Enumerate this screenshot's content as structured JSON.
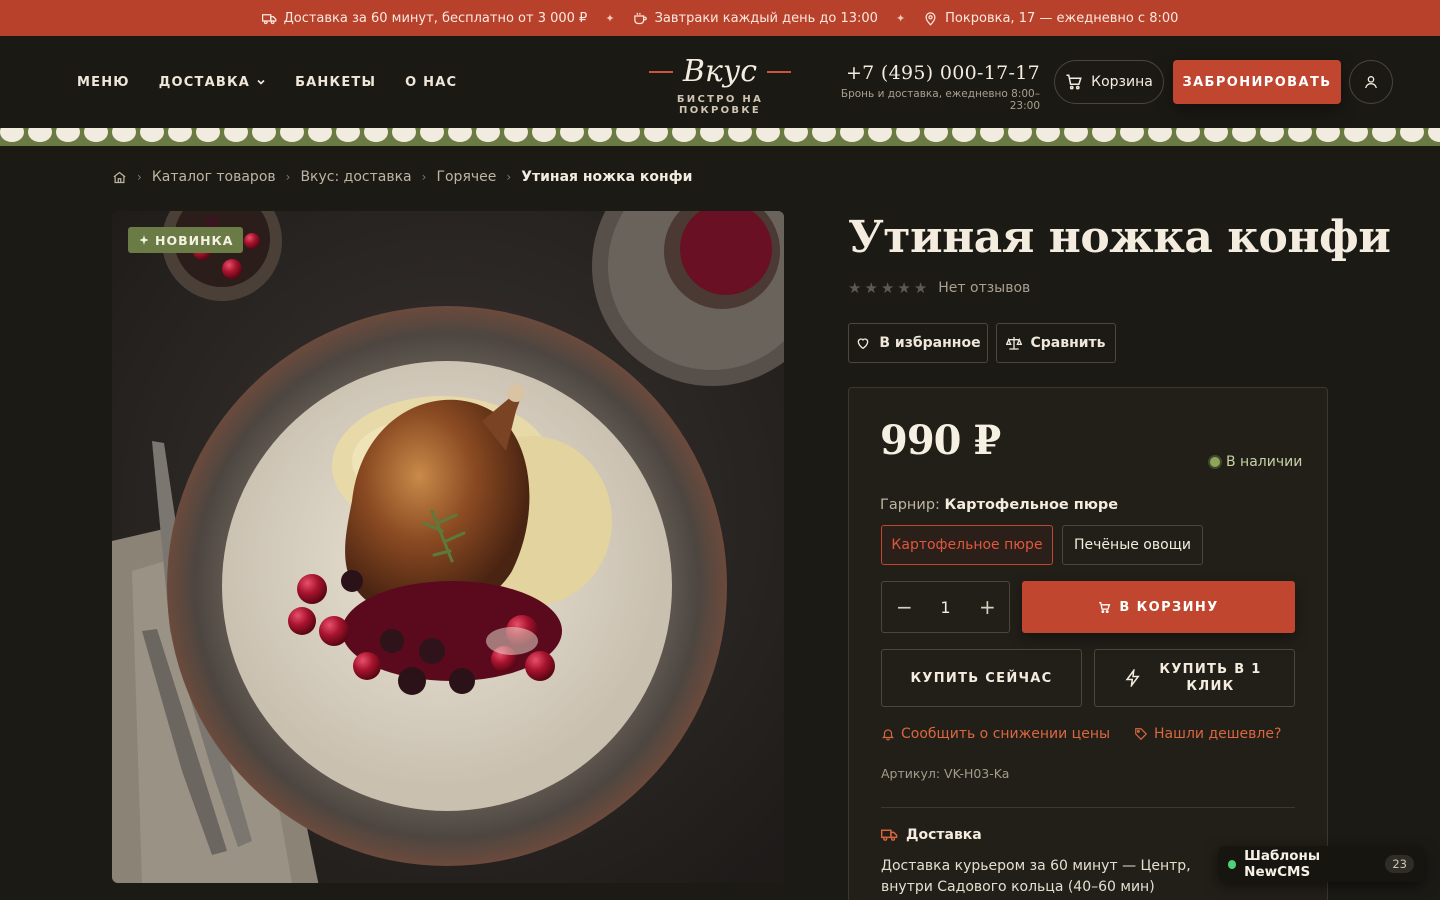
{
  "topbar": {
    "items": [
      {
        "icon": "truck-icon",
        "text": "Доставка за 60 минут, бесплатно от 3 000 ₽"
      },
      {
        "icon": "coffee-icon",
        "text": "Завтраки каждый день до 13:00"
      },
      {
        "icon": "map-pin-icon",
        "text": "Покровка, 17 — ежедневно с 8:00"
      }
    ],
    "separator": "✦"
  },
  "header": {
    "nav": [
      "МЕНЮ",
      "ДОСТАВКА",
      "БАНКЕТЫ",
      "О НАС"
    ],
    "logo": {
      "name": "Вкус",
      "tagline": "БИСТРО НА ПОКРОВКЕ"
    },
    "phone": "+7 (495) 000-17-17",
    "phone_note": "Бронь и доставка, ежедневно 8:00–23:00",
    "cart_label": "Корзина",
    "book_label": "ЗАБРОНИРОВАТЬ"
  },
  "breadcrumbs": [
    "Каталог товаров",
    "Вкус: доставка",
    "Горячее",
    "Утиная ножка конфи"
  ],
  "product": {
    "badge": "НОВИНКА",
    "title": "Утиная ножка конфи",
    "rating_text": "Нет отзывов",
    "stars": 0,
    "favorite_label": "В избранное",
    "compare_label": "Сравнить",
    "price": "990 ₽",
    "stock": "В наличии",
    "garnish_label": "Гарнир:",
    "garnish_value": "Картофельное пюре",
    "options": [
      "Картофельное пюре",
      "Печёные овощи"
    ],
    "selected_option": "Картофельное пюре",
    "quantity": "1",
    "to_cart_label": "В КОРЗИНУ",
    "buy_now_label": "КУПИТЬ СЕЙЧАС",
    "one_click_label": "КУПИТЬ В 1 КЛИК",
    "price_alert_label": "Сообщить о снижении цены",
    "cheaper_label": "Нашли дешевле?",
    "sku": "Артикул: VK-H03-Ka",
    "delivery_title": "Доставка",
    "delivery_text": "Доставка курьером за 60 минут — Центр, внутри Садового кольца (40–60 мин)"
  },
  "widget": {
    "label": "Шаблоны NewCMS",
    "count": "23"
  },
  "colors": {
    "accent": "#c0462f",
    "topbar": "#b8412c",
    "band": "#6a7a43",
    "background": "#1c1a15"
  }
}
